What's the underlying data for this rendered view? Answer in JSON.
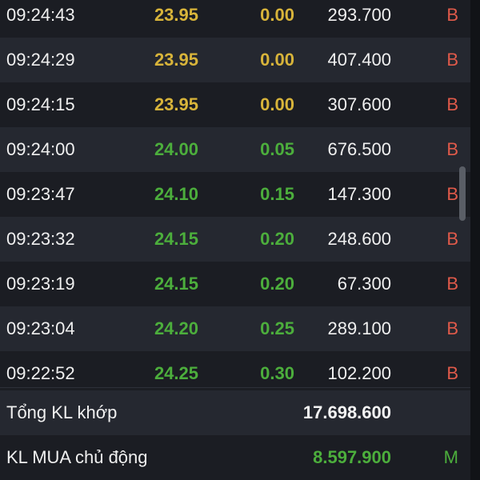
{
  "trades": [
    {
      "time": "09:24:43",
      "price": "23.95",
      "change": "0.00",
      "volume": "293.700",
      "side": "B",
      "tone": "ref"
    },
    {
      "time": "09:24:29",
      "price": "23.95",
      "change": "0.00",
      "volume": "407.400",
      "side": "B",
      "tone": "ref"
    },
    {
      "time": "09:24:15",
      "price": "23.95",
      "change": "0.00",
      "volume": "307.600",
      "side": "B",
      "tone": "ref"
    },
    {
      "time": "09:24:00",
      "price": "24.00",
      "change": "0.05",
      "volume": "676.500",
      "side": "B",
      "tone": "up"
    },
    {
      "time": "09:23:47",
      "price": "24.10",
      "change": "0.15",
      "volume": "147.300",
      "side": "B",
      "tone": "up"
    },
    {
      "time": "09:23:32",
      "price": "24.15",
      "change": "0.20",
      "volume": "248.600",
      "side": "B",
      "tone": "up"
    },
    {
      "time": "09:23:19",
      "price": "24.15",
      "change": "0.20",
      "volume": "67.300",
      "side": "B",
      "tone": "up"
    },
    {
      "time": "09:23:04",
      "price": "24.20",
      "change": "0.25",
      "volume": "289.100",
      "side": "B",
      "tone": "up"
    },
    {
      "time": "09:22:52",
      "price": "24.25",
      "change": "0.30",
      "volume": "102.200",
      "side": "B",
      "tone": "up"
    }
  ],
  "summary": {
    "total_label": "Tổng KL khớp",
    "total_value": "17.698.600",
    "active_buy_label": "KL MUA chủ động",
    "active_buy_value": "8.597.900",
    "active_buy_side": "M"
  },
  "colors": {
    "background": "#1b1d23",
    "row_alt": "#252830",
    "reference_yellow": "#d8b43a",
    "up_green": "#4cae3c",
    "sell_red": "#e05a4a"
  },
  "scroll": {
    "position_fraction": 0.43
  }
}
